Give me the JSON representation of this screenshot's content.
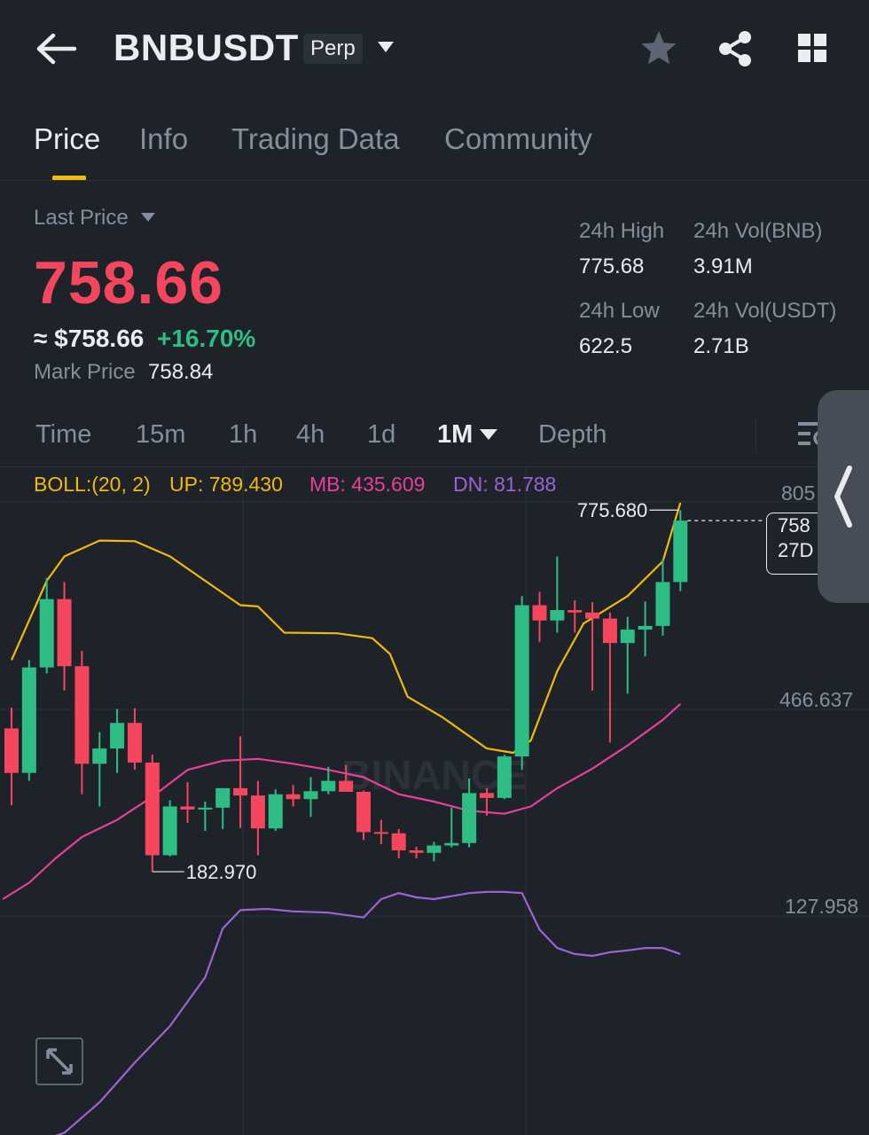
{
  "header": {
    "pair": "BNBUSDT",
    "contract_badge": "Perp",
    "icons": [
      "back-arrow-icon",
      "caret-down-icon",
      "star-icon",
      "share-icon",
      "grid-icon"
    ]
  },
  "tabs": [
    {
      "label": "Price",
      "active": true
    },
    {
      "label": "Info",
      "active": false
    },
    {
      "label": "Trading Data",
      "active": false
    },
    {
      "label": "Community",
      "active": false
    }
  ],
  "price": {
    "last_price_label": "Last Price",
    "last_price": "758.66",
    "usd_equiv": "≈ $758.66",
    "change_pct": "+16.70%",
    "mark_price_label": "Mark Price",
    "mark_price": "758.84"
  },
  "stats": {
    "high_label": "24h High",
    "high": "775.68",
    "vol_bnb_label": "24h Vol(BNB)",
    "vol_bnb": "3.91M",
    "low_label": "24h Low",
    "low": "622.5",
    "vol_usdt_label": "24h Vol(USDT)",
    "vol_usdt": "2.71B"
  },
  "intervals": [
    {
      "label": "Time",
      "active": false
    },
    {
      "label": "15m",
      "active": false
    },
    {
      "label": "1h",
      "active": false
    },
    {
      "label": "4h",
      "active": false
    },
    {
      "label": "1d",
      "active": false
    },
    {
      "label": "1M",
      "active": true
    },
    {
      "label": "Depth",
      "active": false
    }
  ],
  "indicator": {
    "name": "BOLL:(20, 2)",
    "up": "UP: 789.430",
    "mb": "MB: 435.609",
    "dn": "DN: 81.788"
  },
  "colors": {
    "up": "#2ebd85",
    "down": "#f6465d",
    "accent": "#f0b90b",
    "boll_up": "#f0b90b",
    "boll_mb": "#e83e9c",
    "boll_dn": "#9d63d4"
  },
  "chart_data": {
    "type": "candlestick",
    "y_tick_labels": [
      "805",
      "466.637",
      "127.958"
    ],
    "high_annotation": "775.680",
    "low_annotation": "182.970",
    "current_price_tag": [
      "758",
      "27D"
    ],
    "watermark": "BINANCE",
    "candles": [
      {
        "o": 418,
        "h": 452,
        "l": 292,
        "c": 345
      },
      {
        "o": 345,
        "h": 530,
        "l": 332,
        "c": 518
      },
      {
        "o": 518,
        "h": 665,
        "l": 508,
        "c": 630
      },
      {
        "o": 630,
        "h": 658,
        "l": 480,
        "c": 520
      },
      {
        "o": 520,
        "h": 545,
        "l": 310,
        "c": 360
      },
      {
        "o": 360,
        "h": 412,
        "l": 290,
        "c": 385
      },
      {
        "o": 385,
        "h": 450,
        "l": 345,
        "c": 427
      },
      {
        "o": 427,
        "h": 451,
        "l": 350,
        "c": 362
      },
      {
        "o": 362,
        "h": 375,
        "l": 183,
        "c": 210
      },
      {
        "o": 210,
        "h": 300,
        "l": 208,
        "c": 290
      },
      {
        "o": 290,
        "h": 330,
        "l": 263,
        "c": 285
      },
      {
        "o": 285,
        "h": 298,
        "l": 250,
        "c": 288
      },
      {
        "o": 288,
        "h": 320,
        "l": 253,
        "c": 320
      },
      {
        "o": 320,
        "h": 405,
        "l": 255,
        "c": 308
      },
      {
        "o": 308,
        "h": 332,
        "l": 210,
        "c": 254
      },
      {
        "o": 254,
        "h": 318,
        "l": 250,
        "c": 310
      },
      {
        "o": 310,
        "h": 325,
        "l": 290,
        "c": 302
      },
      {
        "o": 302,
        "h": 338,
        "l": 273,
        "c": 315
      },
      {
        "o": 315,
        "h": 355,
        "l": 310,
        "c": 332
      },
      {
        "o": 332,
        "h": 358,
        "l": 315,
        "c": 314
      },
      {
        "o": 314,
        "h": 316,
        "l": 235,
        "c": 248
      },
      {
        "o": 248,
        "h": 268,
        "l": 228,
        "c": 246
      },
      {
        "o": 246,
        "h": 253,
        "l": 205,
        "c": 218
      },
      {
        "o": 218,
        "h": 224,
        "l": 205,
        "c": 214
      },
      {
        "o": 214,
        "h": 232,
        "l": 200,
        "c": 226
      },
      {
        "o": 226,
        "h": 288,
        "l": 223,
        "c": 230
      },
      {
        "o": 230,
        "h": 336,
        "l": 223,
        "c": 312
      },
      {
        "o": 312,
        "h": 320,
        "l": 275,
        "c": 304
      },
      {
        "o": 304,
        "h": 375,
        "l": 302,
        "c": 372
      },
      {
        "o": 372,
        "h": 635,
        "l": 350,
        "c": 620
      },
      {
        "o": 620,
        "h": 642,
        "l": 560,
        "c": 595
      },
      {
        "o": 595,
        "h": 700,
        "l": 575,
        "c": 612
      },
      {
        "o": 612,
        "h": 628,
        "l": 575,
        "c": 608
      },
      {
        "o": 608,
        "h": 625,
        "l": 480,
        "c": 598
      },
      {
        "o": 598,
        "h": 608,
        "l": 395,
        "c": 558
      },
      {
        "o": 558,
        "h": 601,
        "l": 475,
        "c": 580
      },
      {
        "o": 580,
        "h": 626,
        "l": 536,
        "c": 586
      },
      {
        "o": 586,
        "h": 695,
        "l": 570,
        "c": 658
      },
      {
        "o": 658,
        "h": 776,
        "l": 643,
        "c": 758.66
      }
    ],
    "boll_up": [
      {
        "i": 0,
        "v": 530
      },
      {
        "i": 2,
        "v": 660
      },
      {
        "i": 3,
        "v": 700
      },
      {
        "i": 5,
        "v": 726
      },
      {
        "i": 7,
        "v": 725
      },
      {
        "i": 9,
        "v": 700
      },
      {
        "i": 11,
        "v": 660
      },
      {
        "i": 13,
        "v": 620
      },
      {
        "i": 14,
        "v": 618
      },
      {
        "i": 15.5,
        "v": 575
      },
      {
        "i": 18.5,
        "v": 574
      },
      {
        "i": 20.5,
        "v": 566
      },
      {
        "i": 21.5,
        "v": 540
      },
      {
        "i": 22.5,
        "v": 470
      },
      {
        "i": 24.5,
        "v": 436
      },
      {
        "i": 27,
        "v": 385
      },
      {
        "i": 28.5,
        "v": 378
      },
      {
        "i": 29.5,
        "v": 398
      },
      {
        "i": 31,
        "v": 512
      },
      {
        "i": 32.5,
        "v": 590
      },
      {
        "i": 35,
        "v": 635
      },
      {
        "i": 37,
        "v": 692
      },
      {
        "i": 38,
        "v": 788
      }
    ],
    "boll_mb": [
      {
        "i": -0.5,
        "v": 138
      },
      {
        "i": 1,
        "v": 165
      },
      {
        "i": 2.5,
        "v": 205
      },
      {
        "i": 4,
        "v": 240
      },
      {
        "i": 6,
        "v": 268
      },
      {
        "i": 8,
        "v": 306
      },
      {
        "i": 10,
        "v": 350
      },
      {
        "i": 12,
        "v": 365
      },
      {
        "i": 14,
        "v": 368
      },
      {
        "i": 16,
        "v": 360
      },
      {
        "i": 18,
        "v": 350
      },
      {
        "i": 20,
        "v": 338
      },
      {
        "i": 22,
        "v": 310
      },
      {
        "i": 24,
        "v": 298
      },
      {
        "i": 26,
        "v": 283
      },
      {
        "i": 28,
        "v": 278
      },
      {
        "i": 29.5,
        "v": 290
      },
      {
        "i": 31,
        "v": 320
      },
      {
        "i": 33,
        "v": 352
      },
      {
        "i": 35,
        "v": 390
      },
      {
        "i": 37,
        "v": 432
      },
      {
        "i": 38,
        "v": 458
      }
    ],
    "boll_dn": [
      {
        "i": -0.5,
        "v": -255
      },
      {
        "i": 2,
        "v": -255
      },
      {
        "i": 3,
        "v": -245
      },
      {
        "i": 5,
        "v": -195
      },
      {
        "i": 7,
        "v": -130
      },
      {
        "i": 9,
        "v": -70
      },
      {
        "i": 11,
        "v": 10
      },
      {
        "i": 12,
        "v": 90
      },
      {
        "i": 13,
        "v": 120
      },
      {
        "i": 14.5,
        "v": 122
      },
      {
        "i": 16,
        "v": 118
      },
      {
        "i": 18,
        "v": 116
      },
      {
        "i": 20,
        "v": 108
      },
      {
        "i": 21,
        "v": 138
      },
      {
        "i": 22,
        "v": 148
      },
      {
        "i": 23,
        "v": 141
      },
      {
        "i": 24,
        "v": 138
      },
      {
        "i": 26,
        "v": 148
      },
      {
        "i": 27,
        "v": 150
      },
      {
        "i": 28,
        "v": 150
      },
      {
        "i": 29,
        "v": 148
      },
      {
        "i": 30,
        "v": 88
      },
      {
        "i": 31,
        "v": 58
      },
      {
        "i": 32,
        "v": 48
      },
      {
        "i": 33,
        "v": 45
      },
      {
        "i": 34,
        "v": 51
      },
      {
        "i": 35,
        "v": 54
      },
      {
        "i": 36,
        "v": 58
      },
      {
        "i": 37,
        "v": 58
      },
      {
        "i": 38,
        "v": 48
      }
    ]
  }
}
